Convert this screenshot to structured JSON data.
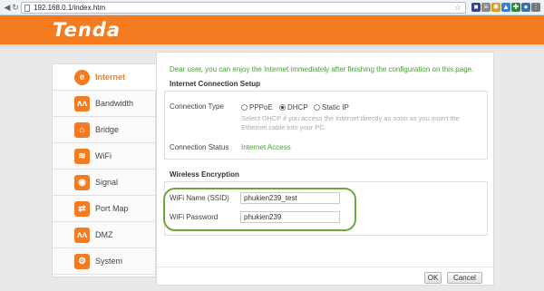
{
  "browser": {
    "url": "192.168.0.1/index.htm",
    "back_glyph": "◀",
    "refresh_glyph": "↻",
    "star_glyph": "☆",
    "extension_icons": [
      {
        "name": "extension-icon-1",
        "color": "#3b3f8f",
        "glyph": "■"
      },
      {
        "name": "extension-icon-2",
        "color": "#8a8a8a",
        "glyph": "≡"
      },
      {
        "name": "extension-icon-3",
        "color": "#d4a019",
        "glyph": "✱"
      },
      {
        "name": "extension-icon-4",
        "color": "#3d7fcf",
        "glyph": "▲"
      },
      {
        "name": "extension-icon-5",
        "color": "#2a8a3a",
        "glyph": "✚"
      },
      {
        "name": "extension-icon-6",
        "color": "#3a6fb3",
        "glyph": "●"
      },
      {
        "name": "extension-icon-7",
        "color": "#777777",
        "glyph": "⋮"
      }
    ]
  },
  "header": {
    "logo": "Tenda",
    "brand_color": "#f57b20"
  },
  "sidebar": {
    "items": [
      {
        "label": "Internet",
        "icon": "internet-icon",
        "glyph": "e",
        "active": true
      },
      {
        "label": "Bandwidth",
        "icon": "bandwidth-icon",
        "glyph": "ʌʌ",
        "active": false
      },
      {
        "label": "Bridge",
        "icon": "bridge-icon",
        "glyph": "⌂",
        "active": false
      },
      {
        "label": "WiFi",
        "icon": "wifi-icon",
        "glyph": "≋",
        "active": false
      },
      {
        "label": "Signal",
        "icon": "signal-icon",
        "glyph": "◉",
        "active": false
      },
      {
        "label": "Port Map",
        "icon": "port-map-icon",
        "glyph": "⇄",
        "active": false
      },
      {
        "label": "DMZ",
        "icon": "dmz-icon",
        "glyph": "ʌʌ",
        "active": false
      },
      {
        "label": "System",
        "icon": "system-icon",
        "glyph": "⚙",
        "active": false
      }
    ]
  },
  "main": {
    "intro": "Dear user, you can enjoy the Internet immediately after finishing the configuration on this page.",
    "internet": {
      "title": "Internet Connection Setup",
      "connection_type_label": "Connection Type",
      "options": [
        "PPPoE",
        "DHCP",
        "Static IP"
      ],
      "selected": "DHCP",
      "hint": "Select DHCP if you access the Internet directly as soon as you insert the Ethernet cable into your PC.",
      "status_label": "Connection Status",
      "status_value": "Internet Access"
    },
    "wireless": {
      "title": "Wireless Encryption",
      "ssid_label": "WiFi Name (SSID)",
      "ssid_value": "phukien239_test",
      "password_label": "WiFi Password",
      "password_value": "phukien239",
      "highlight_color": "#6fa83a"
    },
    "buttons": {
      "ok": "OK",
      "cancel": "Cancel"
    }
  }
}
